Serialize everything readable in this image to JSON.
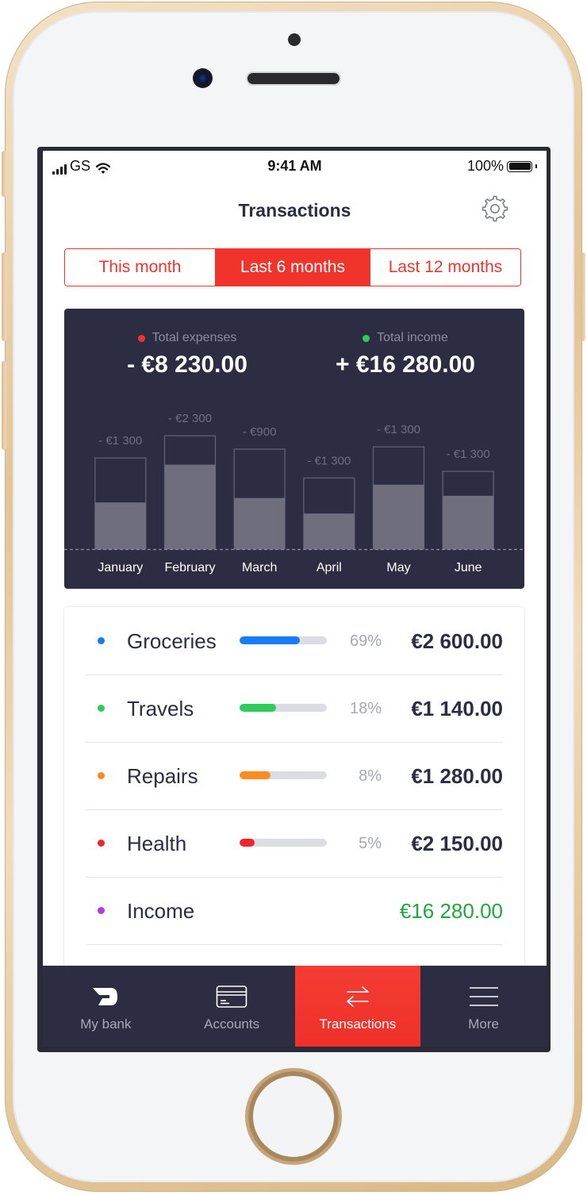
{
  "status_bar": {
    "carrier": "GS",
    "time": "9:41 AM",
    "battery": "100%"
  },
  "header": {
    "title": "Transactions"
  },
  "period_tabs": [
    {
      "label": "This month",
      "active": false
    },
    {
      "label": "Last 6 months",
      "active": true
    },
    {
      "label": "Last 12 months",
      "active": false
    }
  ],
  "summary": {
    "expenses_label": "Total expenses",
    "expenses_amount": "- €8 230.00",
    "expenses_color": "#f0342b",
    "income_label": "Total income",
    "income_amount": "+ €16 280.00",
    "income_color": "#2ecc5a"
  },
  "chart_data": {
    "type": "bar",
    "categories": [
      "January",
      "February",
      "March",
      "April",
      "May",
      "June"
    ],
    "value_labels": [
      "- €1 300",
      "- €2 300",
      "- €900",
      "- €1 300",
      "- €1 300",
      "- €1 300"
    ],
    "series": [
      {
        "values": [
          2.1,
          3.8,
          2.3,
          1.6,
          2.9,
          2.4
        ]
      },
      {
        "values": [
          4.1,
          5.1,
          4.5,
          3.2,
          4.6,
          3.5
        ]
      }
    ],
    "ylim": [
      0,
      6
    ],
    "grid": false,
    "baseline_dashed": true
  },
  "categories": [
    {
      "name": "Groceries",
      "percent_label": "69%",
      "percent": 0.69,
      "amount": "€2 600.00",
      "color": "#1a7cf5",
      "amount_color": "#2b2d42"
    },
    {
      "name": "Travels",
      "percent_label": "18%",
      "percent": 0.42,
      "amount": "€1 140.00",
      "color": "#2ecc5a",
      "amount_color": "#2b2d42"
    },
    {
      "name": "Repairs",
      "percent_label": "8%",
      "percent": 0.35,
      "amount": "€1 280.00",
      "color": "#ff8a1f",
      "amount_color": "#2b2d42"
    },
    {
      "name": "Health",
      "percent_label": "5%",
      "percent": 0.17,
      "amount": "€2 150.00",
      "color": "#f0242f",
      "amount_color": "#2b2d42"
    },
    {
      "name": "Income",
      "percent_label": "",
      "percent": null,
      "amount": "€16 280.00",
      "color": "#b43ae8",
      "amount_color": "#1fa83c"
    }
  ],
  "tab_bar": [
    {
      "label": "My bank",
      "icon": "bank-logo-icon",
      "active": false
    },
    {
      "label": "Accounts",
      "icon": "card-icon",
      "active": false
    },
    {
      "label": "Transactions",
      "icon": "transfer-arrows-icon",
      "active": true
    },
    {
      "label": "More",
      "icon": "menu-icon",
      "active": false
    }
  ]
}
